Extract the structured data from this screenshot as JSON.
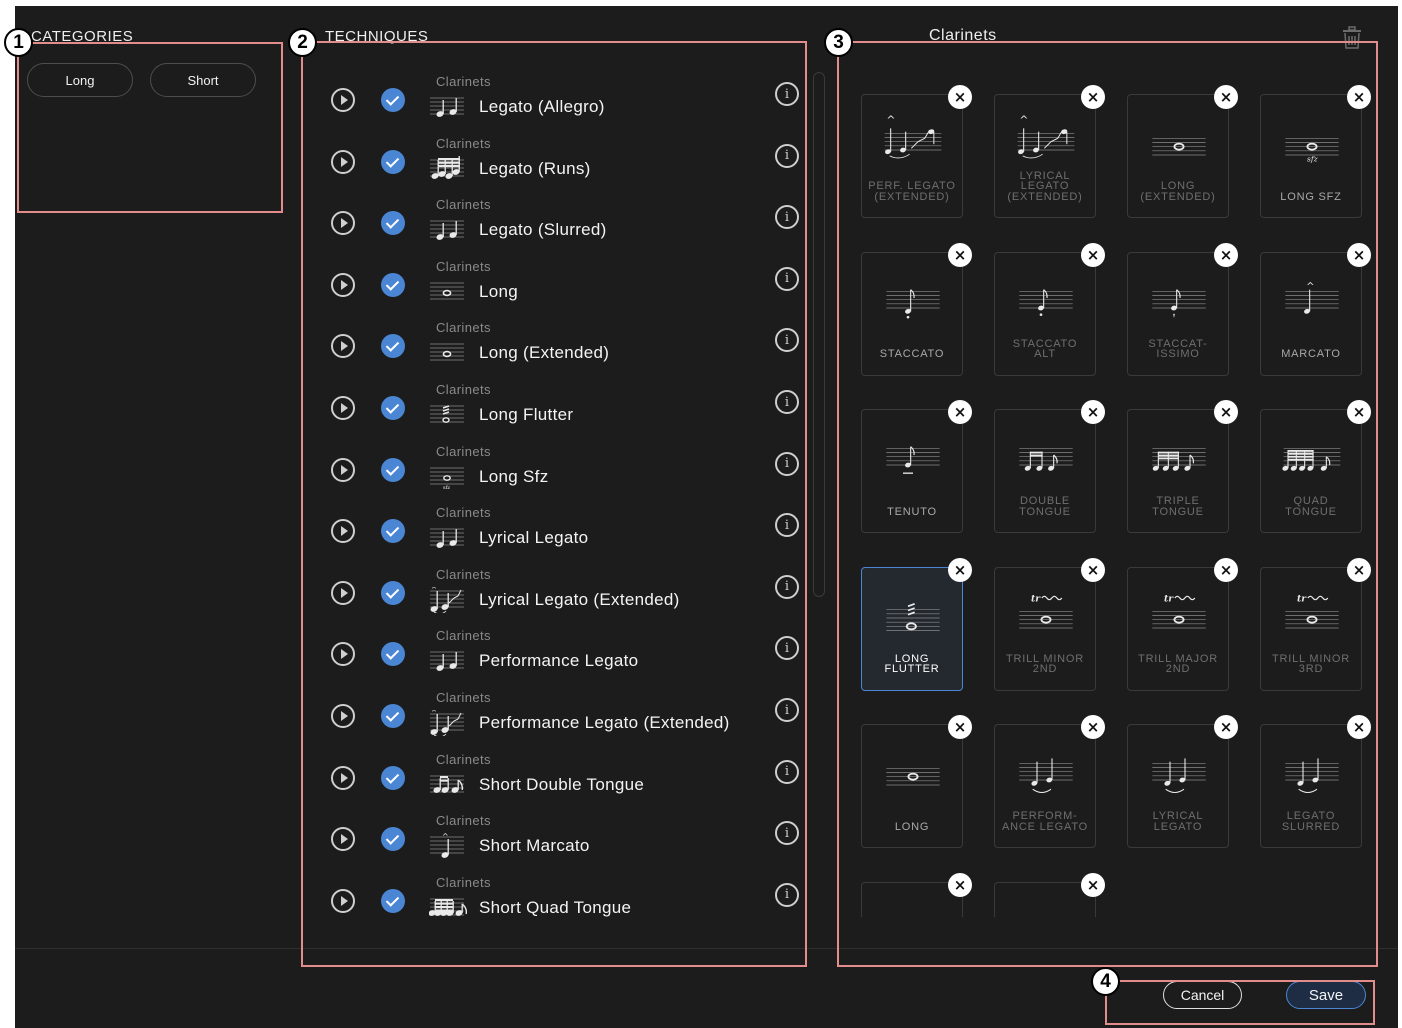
{
  "sections": {
    "categories_title": "CATEGORIES",
    "techniques_title": "TECHNIQUES",
    "panel_title": "Clarinets"
  },
  "markers": [
    "1",
    "2",
    "3",
    "4"
  ],
  "categories": [
    {
      "label": "Long"
    },
    {
      "label": "Short"
    }
  ],
  "techniques": [
    {
      "category": "Clarinets",
      "name": "Legato (Allegro)",
      "icon": "two-notes-icon",
      "checked": true
    },
    {
      "category": "Clarinets",
      "name": "Legato (Runs)",
      "icon": "runs-icon",
      "checked": true
    },
    {
      "category": "Clarinets",
      "name": "Legato (Slurred)",
      "icon": "two-notes-icon",
      "checked": true
    },
    {
      "category": "Clarinets",
      "name": "Long",
      "icon": "whole-note-icon",
      "checked": true
    },
    {
      "category": "Clarinets",
      "name": "Long (Extended)",
      "icon": "whole-note-icon",
      "checked": true
    },
    {
      "category": "Clarinets",
      "name": "Long Flutter",
      "icon": "flutter-icon",
      "checked": true
    },
    {
      "category": "Clarinets",
      "name": "Long Sfz",
      "icon": "sfz-icon",
      "checked": true
    },
    {
      "category": "Clarinets",
      "name": "Lyrical Legato",
      "icon": "two-notes-icon",
      "checked": true
    },
    {
      "category": "Clarinets",
      "name": "Lyrical Legato (Extended)",
      "icon": "legato-extended-icon",
      "checked": true
    },
    {
      "category": "Clarinets",
      "name": "Performance Legato",
      "icon": "two-notes-icon",
      "checked": true
    },
    {
      "category": "Clarinets",
      "name": "Performance Legato (Extended)",
      "icon": "legato-extended-icon",
      "checked": true
    },
    {
      "category": "Clarinets",
      "name": "Short Double Tongue",
      "icon": "double-tongue-icon",
      "checked": true
    },
    {
      "category": "Clarinets",
      "name": "Short Marcato",
      "icon": "marcato-icon",
      "checked": true
    },
    {
      "category": "Clarinets",
      "name": "Short Quad Tongue",
      "icon": "quad-tongue-icon",
      "checked": true
    }
  ],
  "tiles": [
    {
      "label": "PERF. LEGATO (EXTENDED)",
      "glyph": "legato-extended",
      "selected": false
    },
    {
      "label": "LYRICAL LEGATO (EXTENDED)",
      "glyph": "legato-extended",
      "selected": false
    },
    {
      "label": "LONG (EXTENDED)",
      "glyph": "whole-note",
      "selected": false
    },
    {
      "label": "LONG SFZ",
      "glyph": "sfz",
      "selected": false
    },
    {
      "label": "STACCATO",
      "glyph": "staccato",
      "selected": false
    },
    {
      "label": "STACCATO ALT",
      "glyph": "staccato-alt",
      "selected": false
    },
    {
      "label": "STACCAT- ISSIMO",
      "glyph": "staccatissimo",
      "selected": false
    },
    {
      "label": "MARCATO",
      "glyph": "marcato",
      "selected": false
    },
    {
      "label": "TENUTO",
      "glyph": "tenuto",
      "selected": false
    },
    {
      "label": "DOUBLE TONGUE",
      "glyph": "double-tongue",
      "selected": false
    },
    {
      "label": "TRIPLE TONGUE",
      "glyph": "triple-tongue",
      "selected": false
    },
    {
      "label": "QUAD TONGUE",
      "glyph": "quad-tongue",
      "selected": false
    },
    {
      "label": "LONG FLUTTER",
      "glyph": "flutter",
      "selected": true
    },
    {
      "label": "TRILL MINOR 2nd",
      "glyph": "trill",
      "selected": false
    },
    {
      "label": "TRILL MAJOR 2nd",
      "glyph": "trill",
      "selected": false
    },
    {
      "label": "TRILL MINOR 3rd",
      "glyph": "trill",
      "selected": false
    },
    {
      "label": "LONG",
      "glyph": "whole-note",
      "selected": false
    },
    {
      "label": "PERFORM- ANCE LEGATO",
      "glyph": "slur-pair",
      "selected": false
    },
    {
      "label": "LYRICAL LEGATO",
      "glyph": "slur-pair",
      "selected": false
    },
    {
      "label": "LEGATO SLURRED",
      "glyph": "slur-pair",
      "selected": false
    },
    {
      "label": "",
      "glyph": "partial-notes",
      "selected": false
    },
    {
      "label": "",
      "glyph": "partial-runs",
      "selected": false
    }
  ],
  "remove_symbol": "×",
  "play_icon": "play-icon",
  "info_symbol": "i",
  "footer": {
    "cancel_label": "Cancel",
    "save_label": "Save"
  },
  "colors": {
    "background": "#1c1c1c",
    "accent": "#4a86d4",
    "highlight": "#e38c8c"
  }
}
